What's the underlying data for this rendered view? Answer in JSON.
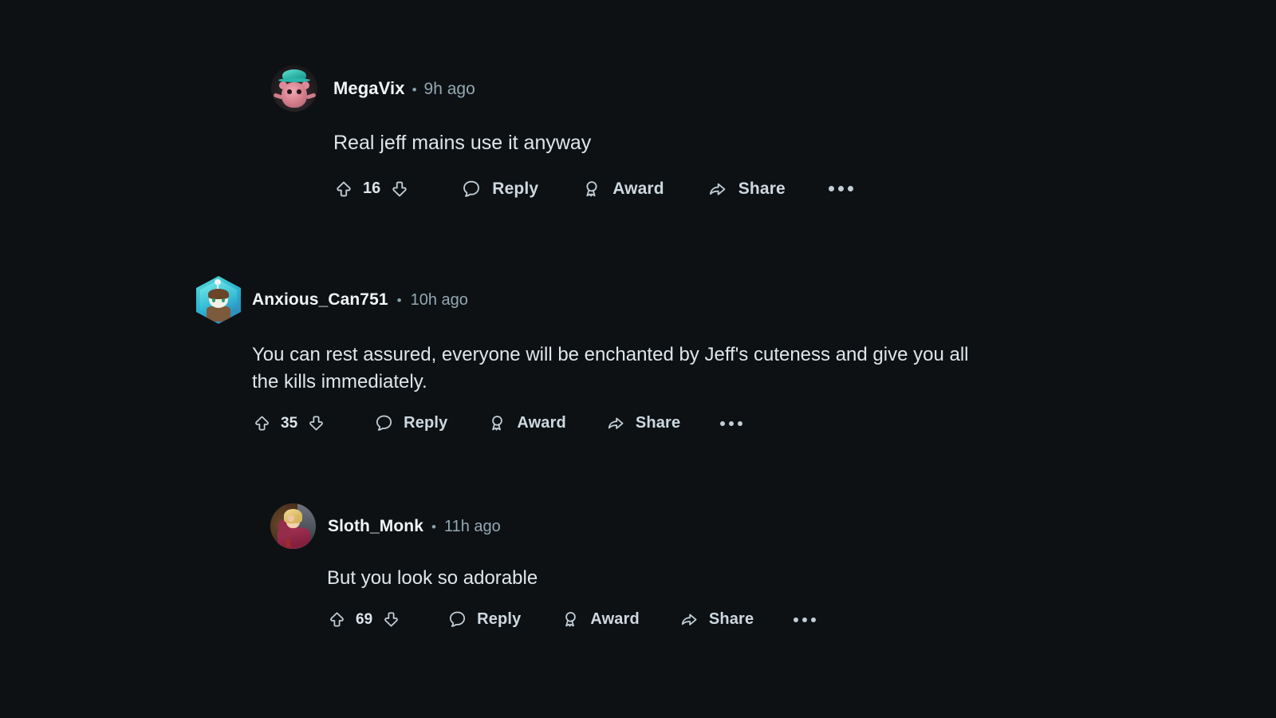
{
  "theme": {
    "background": "#0d1114",
    "username_color": "#f2f4f5",
    "timestamp_color": "#94a8b3",
    "body_color": "#dfe5e9",
    "action_color": "#cdd9e0"
  },
  "comments": [
    {
      "username": "MegaVix",
      "separator": "•",
      "timestamp": "9h ago",
      "body": "Real jeff mains use it anyway",
      "score": "16",
      "avatar": {
        "shape": "circle",
        "description": "pink-creature-with-teal-hat"
      },
      "actions": {
        "upvote": "upvote-icon",
        "downvote": "downvote-icon",
        "reply": "Reply",
        "award": "Award",
        "share": "Share",
        "more": "more-options-icon"
      }
    },
    {
      "username": "Anxious_Can751",
      "separator": "•",
      "timestamp": "10h ago",
      "body": "You can rest assured, everyone will be enchanted by Jeff's cuteness and give you all the kills immediately.",
      "score": "35",
      "avatar": {
        "shape": "hexagon",
        "description": "snoo-avatar-teal-background"
      },
      "actions": {
        "upvote": "upvote-icon",
        "downvote": "downvote-icon",
        "reply": "Reply",
        "award": "Award",
        "share": "Share",
        "more": "more-options-icon"
      }
    },
    {
      "username": "Sloth_Monk",
      "separator": "•",
      "timestamp": "11h ago",
      "body": "But you look so adorable",
      "score": "69",
      "avatar": {
        "shape": "circle",
        "description": "blonde-person-in-maroon-shirt"
      },
      "actions": {
        "upvote": "upvote-icon",
        "downvote": "downvote-icon",
        "reply": "Reply",
        "award": "Award",
        "share": "Share",
        "more": "more-options-icon"
      }
    }
  ]
}
